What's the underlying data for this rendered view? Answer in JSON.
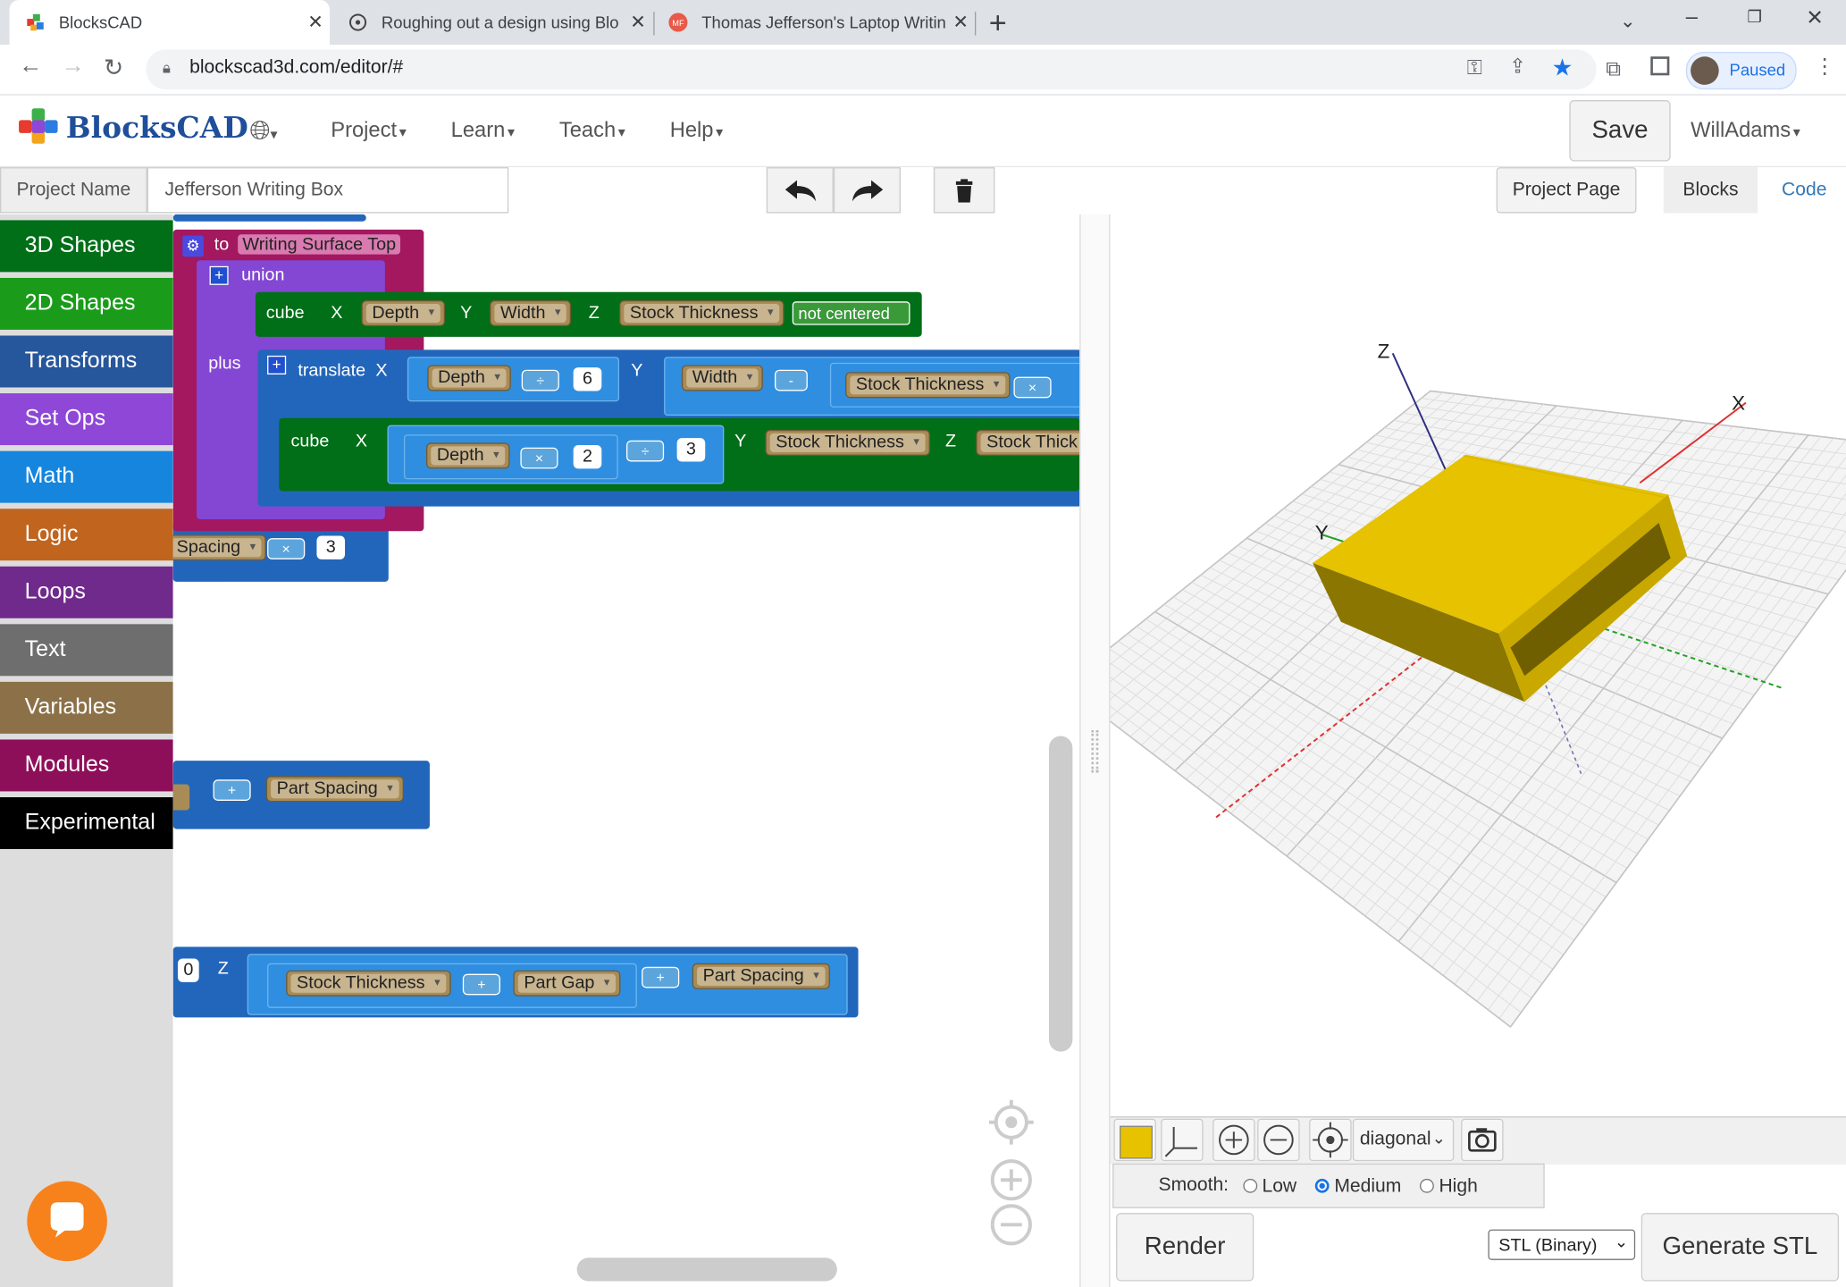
{
  "browser": {
    "tabs": [
      {
        "title": "BlocksCAD",
        "active": true
      },
      {
        "title": "Roughing out a design using Blo",
        "active": false
      },
      {
        "title": "Thomas Jefferson's Laptop Writin",
        "active": false
      }
    ],
    "url": "blockscad3d.com/editor/#",
    "profile_status": "Paused"
  },
  "app": {
    "logo": "BlocksCAD",
    "menu": [
      "Project",
      "Learn",
      "Teach",
      "Help"
    ],
    "save_label": "Save",
    "user": "WillAdams",
    "project_name_label": "Project Name",
    "project_name": "Jefferson Writing Box",
    "project_page_label": "Project Page",
    "view_tabs": [
      "Blocks",
      "Code"
    ]
  },
  "toolbox": [
    {
      "label": "3D Shapes",
      "color": "#006f17"
    },
    {
      "label": "2D Shapes",
      "color": "#1a9c1a"
    },
    {
      "label": "Transforms",
      "color": "#26569b"
    },
    {
      "label": "Set Ops",
      "color": "#8e47d6"
    },
    {
      "label": "Math",
      "color": "#1585dd"
    },
    {
      "label": "Logic",
      "color": "#c1651e"
    },
    {
      "label": "Loops",
      "color": "#702a8c"
    },
    {
      "label": "Text",
      "color": "#6e6e6e"
    },
    {
      "label": "Variables",
      "color": "#8c7148"
    },
    {
      "label": "Modules",
      "color": "#8d0f5a"
    },
    {
      "label": "Experimental",
      "color": "#000000"
    }
  ],
  "blocks": {
    "module_to": "to",
    "module_name": "Writing Surface Top",
    "union": "union",
    "plus": "plus",
    "cube": "cube",
    "translate": "translate",
    "x": "X",
    "y": "Y",
    "z": "Z",
    "not_centered": "not centered",
    "v_depth": "Depth",
    "v_width": "Width",
    "v_stock": "Stock Thickness",
    "v_stock_cut": "Stock Thick",
    "v_spacing_cut": "Spacing",
    "v_part_spacing": "Part Spacing",
    "v_part_gap": "Part Gap",
    "op_div": "÷",
    "op_minus": "-",
    "op_times": "×",
    "op_plus": "+",
    "n6": "6",
    "n2": "2",
    "n3": "3",
    "n0": "0"
  },
  "viewer": {
    "axis_x": "X",
    "axis_y": "Y",
    "axis_z": "Z",
    "model_color": "#e6c200",
    "view_select": "diagonal",
    "smooth_label": "Smooth:",
    "smooth_options": [
      "Low",
      "Medium",
      "High"
    ],
    "smooth_selected": "Medium",
    "render_label": "Render",
    "format_select": "STL (Binary)",
    "generate_label": "Generate STL"
  }
}
